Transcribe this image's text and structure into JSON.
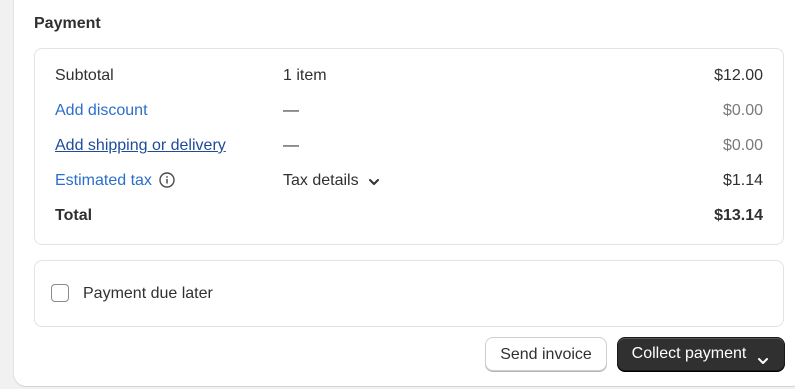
{
  "section": {
    "title": "Payment"
  },
  "summary": {
    "rows": [
      {
        "label": "Subtotal",
        "middle": "1 item",
        "amount": "$12.00"
      },
      {
        "label": "Add discount",
        "middle": "—",
        "amount": "$0.00"
      },
      {
        "label": "Add shipping or delivery",
        "middle": "—",
        "amount": "$0.00"
      },
      {
        "label": "Estimated tax",
        "middle": "Tax details",
        "amount": "$1.14"
      },
      {
        "label": "Total",
        "middle": "",
        "amount": "$13.14"
      }
    ]
  },
  "payment_due_later": {
    "label": "Payment due later",
    "checked": false
  },
  "actions": {
    "send_invoice": "Send invoice",
    "collect_payment": "Collect payment"
  },
  "icons": {
    "info": "info-icon",
    "tax_chevron": "chevron-down-icon",
    "collect_chevron": "chevron-down-icon"
  },
  "colors": {
    "link": "#2c6ecb",
    "primary_button": "#303030",
    "muted_amount": "#7a7a7a"
  }
}
